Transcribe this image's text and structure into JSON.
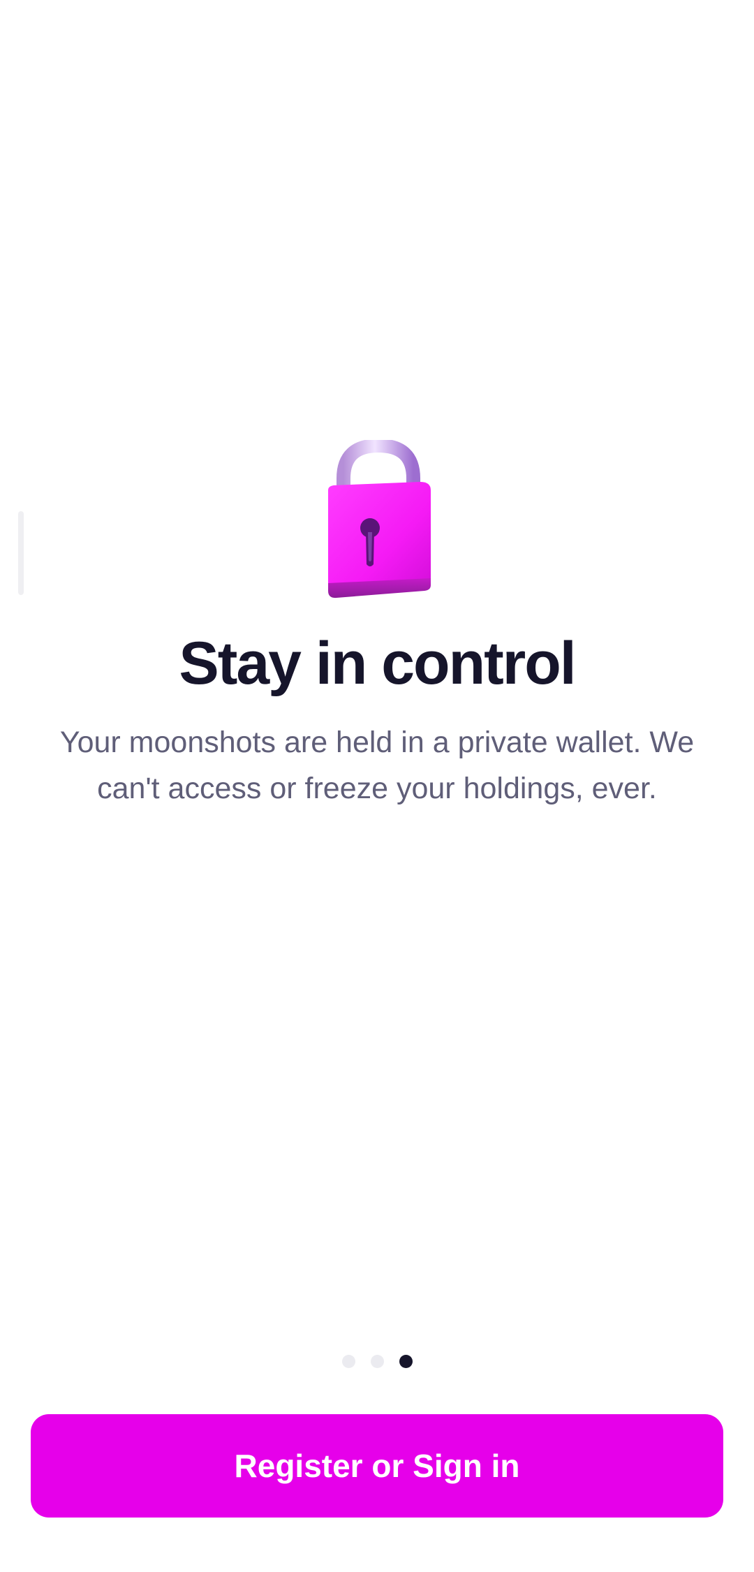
{
  "onboarding": {
    "illustration_icon": "padlock-icon",
    "title": "Stay in control",
    "subtitle": "Your moonshots are held in a private wallet. We can't access or freeze your holdings, ever.",
    "pager": {
      "total": 3,
      "active_index": 2
    },
    "cta_label": "Register or Sign in"
  },
  "colors": {
    "accent": "#e600ea",
    "title": "#16152b",
    "subtitle": "#5f5e78",
    "dot_inactive": "#ebebf0",
    "dot_active": "#16152b"
  }
}
